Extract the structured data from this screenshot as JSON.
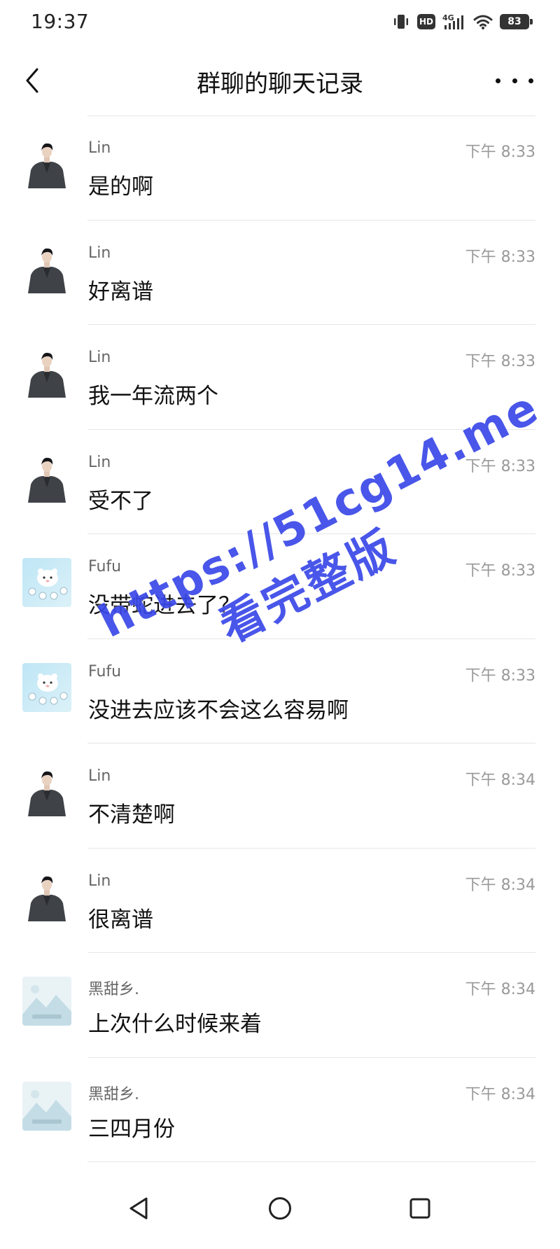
{
  "status_bar": {
    "time": "19:37",
    "hd": "HD",
    "network": "4G",
    "battery": "83"
  },
  "header": {
    "title": "群聊的聊天记录",
    "back_icon": "chevron-left-icon",
    "more_icon": "more-horizontal-icon"
  },
  "messages": [
    {
      "sender": "Lin",
      "time": "下午 8:33",
      "text": "是的啊",
      "avatar": "lin-avatar"
    },
    {
      "sender": "Lin",
      "time": "下午 8:33",
      "text": "好离谱",
      "avatar": "lin-avatar"
    },
    {
      "sender": "Lin",
      "time": "下午 8:33",
      "text": "我一年流两个",
      "avatar": "lin-avatar"
    },
    {
      "sender": "Lin",
      "time": "下午 8:33",
      "text": "受不了",
      "avatar": "lin-avatar"
    },
    {
      "sender": "Fufu",
      "time": "下午 8:33",
      "text": "没带蛇进去了？",
      "avatar": "fufu-avatar"
    },
    {
      "sender": "Fufu",
      "time": "下午 8:33",
      "text": "没进去应该不会这么容易啊",
      "avatar": "fufu-avatar"
    },
    {
      "sender": "Lin",
      "time": "下午 8:34",
      "text": "不清楚啊",
      "avatar": "lin-avatar"
    },
    {
      "sender": "Lin",
      "time": "下午 8:34",
      "text": "很离谱",
      "avatar": "lin-avatar"
    },
    {
      "sender": "黑甜乡.",
      "time": "下午 8:34",
      "text": "上次什么时候来着",
      "avatar": "landscape-avatar"
    },
    {
      "sender": "黑甜乡.",
      "time": "下午 8:34",
      "text": "三四月份",
      "avatar": "landscape-avatar"
    }
  ],
  "watermark": {
    "line1": "https://51cg14.me",
    "line2": "看完整版"
  },
  "nav": {
    "back_icon": "triangle-back-icon",
    "home_icon": "circle-home-icon",
    "recents_icon": "square-recents-icon"
  },
  "colors": {
    "watermark": "#3a48e8",
    "divider": "#e6e6e6",
    "time_text": "#999999"
  }
}
